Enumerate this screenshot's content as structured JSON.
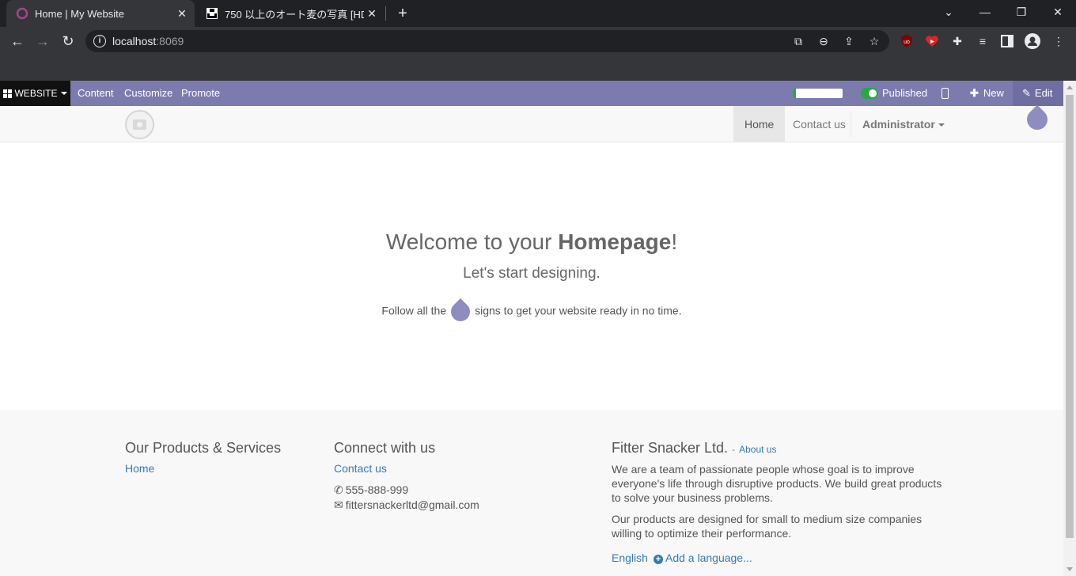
{
  "browser": {
    "tabs": [
      {
        "title": "Home | My Website",
        "active": true
      },
      {
        "title": "750 以上のオート麦の写真 [HD] | Unsplash",
        "active": false
      }
    ],
    "url_host": "localhost",
    "url_port": ":8069"
  },
  "odoo_bar": {
    "website_label": "WEBSITE",
    "menus": [
      "Content",
      "Customize",
      "Promote"
    ],
    "progress_fraction": 0.06,
    "published_label": "Published",
    "new_label": "New",
    "edit_label": "Edit"
  },
  "header": {
    "nav": [
      "Home",
      "Contact us"
    ],
    "user": "Administrator"
  },
  "hero": {
    "title_prefix": "Welcome to your ",
    "title_bold": "Homepage",
    "title_suffix": "!",
    "subtitle": "Let's start designing.",
    "follow_before": "Follow all the",
    "follow_after": "signs to get your website ready in no time."
  },
  "footer": {
    "col1": {
      "title": "Our Products & Services",
      "links": [
        "Home"
      ]
    },
    "col2": {
      "title": "Connect with us",
      "link": "Contact us",
      "phone": "555-888-999",
      "email": "fittersnackerltd@gmail.com"
    },
    "col3": {
      "title": "Fitter Snacker Ltd.",
      "about_sep": "-",
      "about_link": "About us",
      "para1": "We are a team of passionate people whose goal is to improve everyone's life through disruptive products. We build great products to solve your business problems.",
      "para2": "Our products are designed for small to medium size companies willing to optimize their performance.",
      "lang": "English",
      "add_lang": "Add a language..."
    }
  }
}
